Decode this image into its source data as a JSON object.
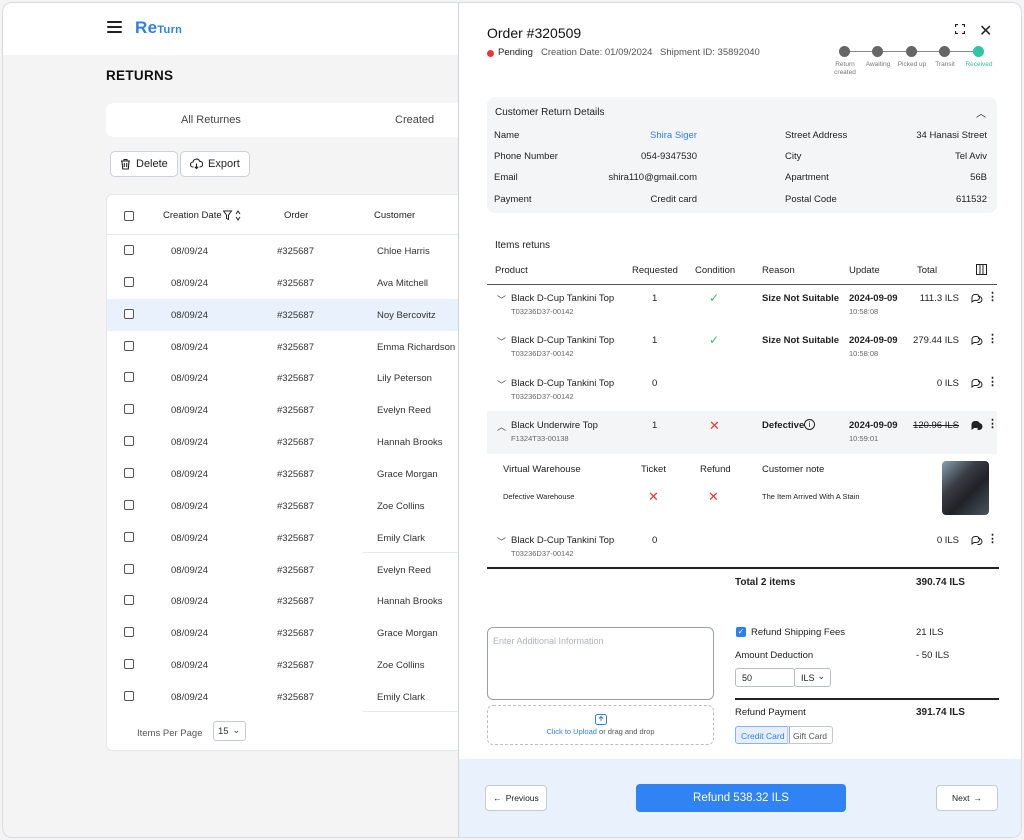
{
  "app": {
    "logo_main": "Re",
    "logo_sub": "Turn"
  },
  "page": {
    "title": "RETURNS"
  },
  "tabs": [
    "All Returnes",
    "Created"
  ],
  "actions": {
    "delete": "Delete",
    "export": "Export"
  },
  "table": {
    "headers": [
      "Creation Date",
      "Order",
      "Customer"
    ],
    "rows": [
      {
        "date": "08/09/24",
        "order": "#325687",
        "customer": "Chloe Harris"
      },
      {
        "date": "08/09/24",
        "order": "#325687",
        "customer": "Ava Mitchell"
      },
      {
        "date": "08/09/24",
        "order": "#325687",
        "customer": "Noy Bercovitz"
      },
      {
        "date": "08/09/24",
        "order": "#325687",
        "customer": "Emma Richardson"
      },
      {
        "date": "08/09/24",
        "order": "#325687",
        "customer": "Lily Peterson"
      },
      {
        "date": "08/09/24",
        "order": "#325687",
        "customer": "Evelyn Reed"
      },
      {
        "date": "08/09/24",
        "order": "#325687",
        "customer": "Hannah Brooks"
      },
      {
        "date": "08/09/24",
        "order": "#325687",
        "customer": "Grace Morgan"
      },
      {
        "date": "08/09/24",
        "order": "#325687",
        "customer": "Zoe Collins"
      },
      {
        "date": "08/09/24",
        "order": "#325687",
        "customer": "Emily Clark"
      },
      {
        "date": "08/09/24",
        "order": "#325687",
        "customer": "Evelyn Reed"
      },
      {
        "date": "08/09/24",
        "order": "#325687",
        "customer": "Hannah Brooks"
      },
      {
        "date": "08/09/24",
        "order": "#325687",
        "customer": "Grace Morgan"
      },
      {
        "date": "08/09/24",
        "order": "#325687",
        "customer": "Zoe Collins"
      },
      {
        "date": "08/09/24",
        "order": "#325687",
        "customer": "Emily Clark"
      }
    ],
    "per_page_label": "Items Per Page",
    "per_page_value": "15"
  },
  "order": {
    "title": "Order #320509",
    "status": "Pending",
    "creation": "Creation Date: 01/09/2024",
    "shipment": "Shipment ID: 35892040",
    "steps": [
      "Return created",
      "Awaiting",
      "Picked up",
      "Transit",
      "Received"
    ]
  },
  "customer": {
    "heading": "Customer Return Details",
    "name_label": "Name",
    "name": "Shira Siger",
    "phone_label": "Phone Number",
    "phone": "054-9347530",
    "email_label": "Email",
    "email": "shira110@gmail.com",
    "payment_label": "Payment",
    "payment": "Credit card",
    "street_label": "Street Address",
    "street": "34 Hanasi Street",
    "city_label": "City",
    "city": "Tel Aviv",
    "apt_label": "Apartment",
    "apt": "56B",
    "postal_label": "Postal Code",
    "postal": "611532"
  },
  "items": {
    "heading": "Items retuns",
    "headers": [
      "Product",
      "Requested",
      "Condition",
      "Reason",
      "Update",
      "Total"
    ],
    "rows": [
      {
        "name": "Black D-Cup Tankini Top",
        "sku": "T03236D37-00142",
        "qty": "1",
        "reason": "Size Not Suitable",
        "date": "2024-09-09",
        "time": "10:58:08",
        "total": "111.3 ILS"
      },
      {
        "name": "Black D-Cup Tankini Top",
        "sku": "T03236D37-00142",
        "qty": "1",
        "reason": "Size Not Suitable",
        "date": "2024-09-09",
        "time": "10:58:08",
        "total": "279.44 ILS"
      },
      {
        "name": "Black D-Cup Tankini Top",
        "sku": "T03236D37-00142",
        "qty": "0",
        "total": "0 ILS"
      },
      {
        "name": "Black Underwire Top",
        "sku": "F1324T33-00138",
        "qty": "1",
        "reason": "Defective",
        "date": "2024-09-09",
        "time": "10:59:01",
        "total": "120.96 ILS"
      },
      {
        "name": "Black D-Cup Tankini Top",
        "sku": "T03236D37-00142",
        "qty": "0",
        "total": "0 ILS"
      }
    ],
    "detail": {
      "headers": [
        "Virtual Warehouse",
        "Ticket",
        "Refund",
        "Customer note"
      ],
      "warehouse": "Defective Warehouse",
      "note": "The Item Arrived With A Stain"
    },
    "total_label": "Total 2 items",
    "total_value": "390.74 ILS"
  },
  "refund": {
    "placeholder": "Enter Additional Information",
    "upload_link": "Click to Upload",
    "upload_rest": " or drag and drop",
    "shipping_label": "Refund Shipping Fees",
    "shipping_value": "21 ILS",
    "deduction_label": "Amount Deduction",
    "deduction_value": "- 50 ILS",
    "deduction_input": "50",
    "currency": "ILS",
    "payment_label": "Refund Payment",
    "payment_value": "391.74 ILS",
    "methods": [
      "Credit Card",
      "Gift Card"
    ]
  },
  "footer": {
    "previous": "Previous",
    "refund_button": "Refund 538.32 ILS",
    "next": "Next"
  },
  "colors": {
    "accent": "#2f7fe8",
    "success": "#2ec4a6",
    "danger": "#e53935",
    "selected_row": "#e9f1fd"
  }
}
